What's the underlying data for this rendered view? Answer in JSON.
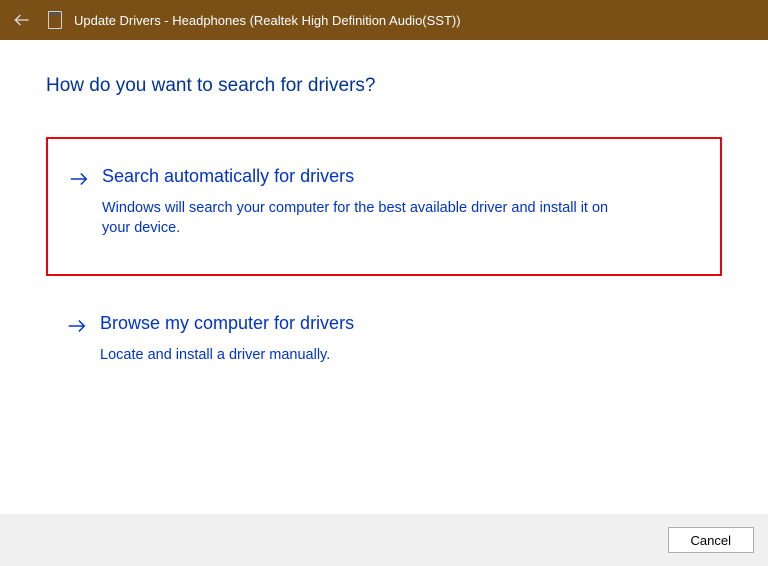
{
  "titlebar": {
    "title": "Update Drivers - Headphones (Realtek High Definition Audio(SST))"
  },
  "heading": "How do you want to search for drivers?",
  "options": [
    {
      "title": "Search automatically for drivers",
      "description": "Windows will search your computer for the best available driver and install it on your device."
    },
    {
      "title": "Browse my computer for drivers",
      "description": "Locate and install a driver manually."
    }
  ],
  "footer": {
    "cancel_label": "Cancel"
  }
}
